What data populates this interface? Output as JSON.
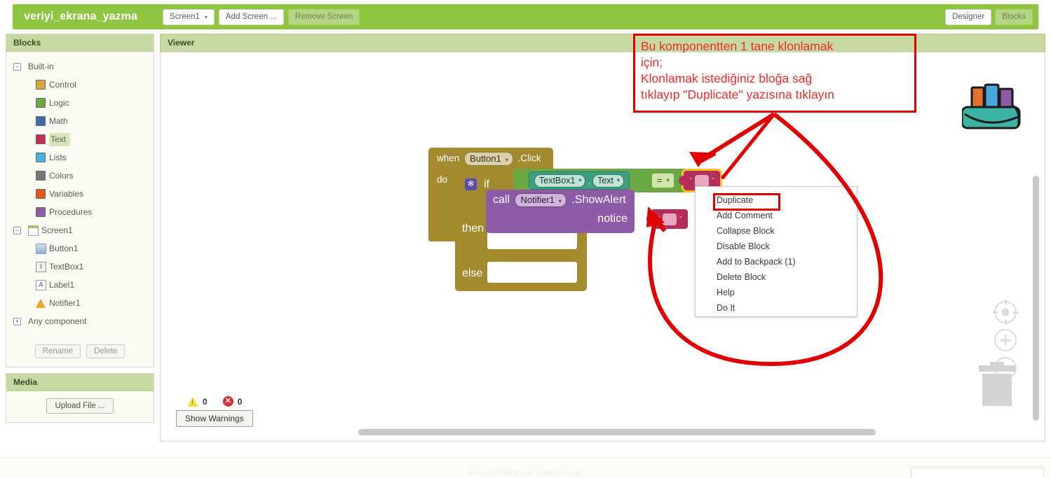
{
  "topbar": {
    "project_title": "veriyi_ekrana_yazma",
    "screen_select": "Screen1",
    "add_screen": "Add Screen ...",
    "remove_screen": "Remove Screen",
    "designer": "Designer",
    "blocks": "Blocks",
    "accent_green": "#8ec63f"
  },
  "blocks_panel": {
    "header": "Blocks",
    "builtin_label": "Built-in",
    "builtin_items": [
      {
        "label": "Control",
        "color": "#d8a93a"
      },
      {
        "label": "Logic",
        "color": "#6aa844"
      },
      {
        "label": "Math",
        "color": "#3b6ea8"
      },
      {
        "label": "Text",
        "color": "#c23057"
      },
      {
        "label": "Lists",
        "color": "#46b1dd"
      },
      {
        "label": "Colors",
        "color": "#787878"
      },
      {
        "label": "Variables",
        "color": "#e4581c"
      },
      {
        "label": "Procedures",
        "color": "#8e5ba6"
      }
    ],
    "selected_builtin": "Text",
    "screen_label": "Screen1",
    "components": [
      {
        "label": "Button1",
        "icon": "button-icon"
      },
      {
        "label": "TextBox1",
        "icon": "textbox-icon"
      },
      {
        "label": "Label1",
        "icon": "label-icon"
      },
      {
        "label": "Notifier1",
        "icon": "notifier-icon"
      }
    ],
    "any_component": "Any component",
    "rename": "Rename",
    "delete": "Delete"
  },
  "media_panel": {
    "header": "Media",
    "upload": "Upload File ..."
  },
  "viewer": {
    "header": "Viewer",
    "warnings_count": "0",
    "errors_count": "0",
    "show_warnings": "Show Warnings"
  },
  "workspace_blocks": {
    "when": {
      "keyword": "when",
      "component": "Button1",
      "event": ".Click",
      "do": "do",
      "color": "#a38a2f"
    },
    "if": {
      "keyword": "if",
      "then": "then",
      "else": "else",
      "color": "#a38a2f"
    },
    "compare": {
      "component": "TextBox1",
      "property": "Text",
      "operator": "=",
      "color": "#6aa844",
      "getter_color": "#3e9e81"
    },
    "call": {
      "keyword": "call",
      "component": "Notifier1",
      "method": ".ShowAlert",
      "arg_label": "notice",
      "color": "#8e5ba6"
    },
    "text_blocks": {
      "color": "#b42d5b",
      "selected_outline": "#ffbf20",
      "quote": "”"
    }
  },
  "context_menu": {
    "items": [
      "Duplicate",
      "Add Comment",
      "Collapse Block",
      "Disable Block",
      "Add to Backpack (1)",
      "Delete Block",
      "Help",
      "Do It"
    ],
    "highlighted": "Duplicate",
    "highlight_color": "#e00000"
  },
  "annotation": {
    "color": "#ef2b2b",
    "lines": [
      "Bu komponentten 1 tane klonlamak",
      "için;",
      "Klonlamak istediğiniz bloğa sağ",
      "tıklayıp \"Duplicate\" yazısına tıklayın"
    ]
  },
  "footer": {
    "text": "Privacy Policy and Terms of Use"
  }
}
